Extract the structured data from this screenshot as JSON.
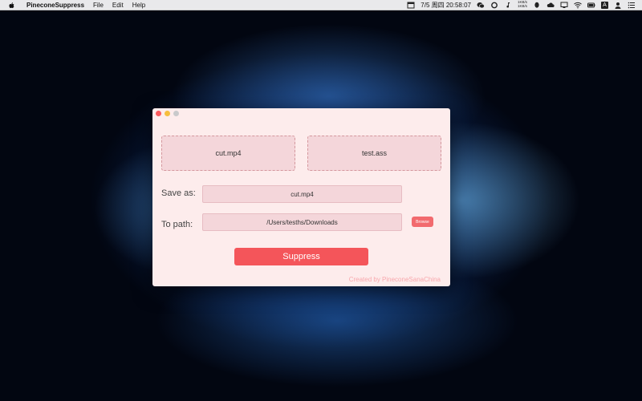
{
  "menubar": {
    "app_name": "PineconeSuppress",
    "menus": [
      "File",
      "Edit",
      "Help"
    ],
    "net_up": "1KB/s",
    "net_down": "1KB/s",
    "datetime": "7/5 周四 20:58:07",
    "input_source": "A"
  },
  "window": {
    "video_file": "cut.mp4",
    "subtitle_file": "test.ass",
    "save_as_label": "Save as:",
    "save_as_value": "cut.mp4",
    "to_path_label": "To path:",
    "to_path_value": "/Users/tesths/Downloads",
    "browse_label": "Browse",
    "suppress_label": "Suppress",
    "credit": "Created by PineconeSanaChina"
  },
  "colors": {
    "window_bg": "#fdecec",
    "accent": "#f4555a",
    "field_bg": "#f4d6da",
    "credit": "#f8a8ad"
  }
}
